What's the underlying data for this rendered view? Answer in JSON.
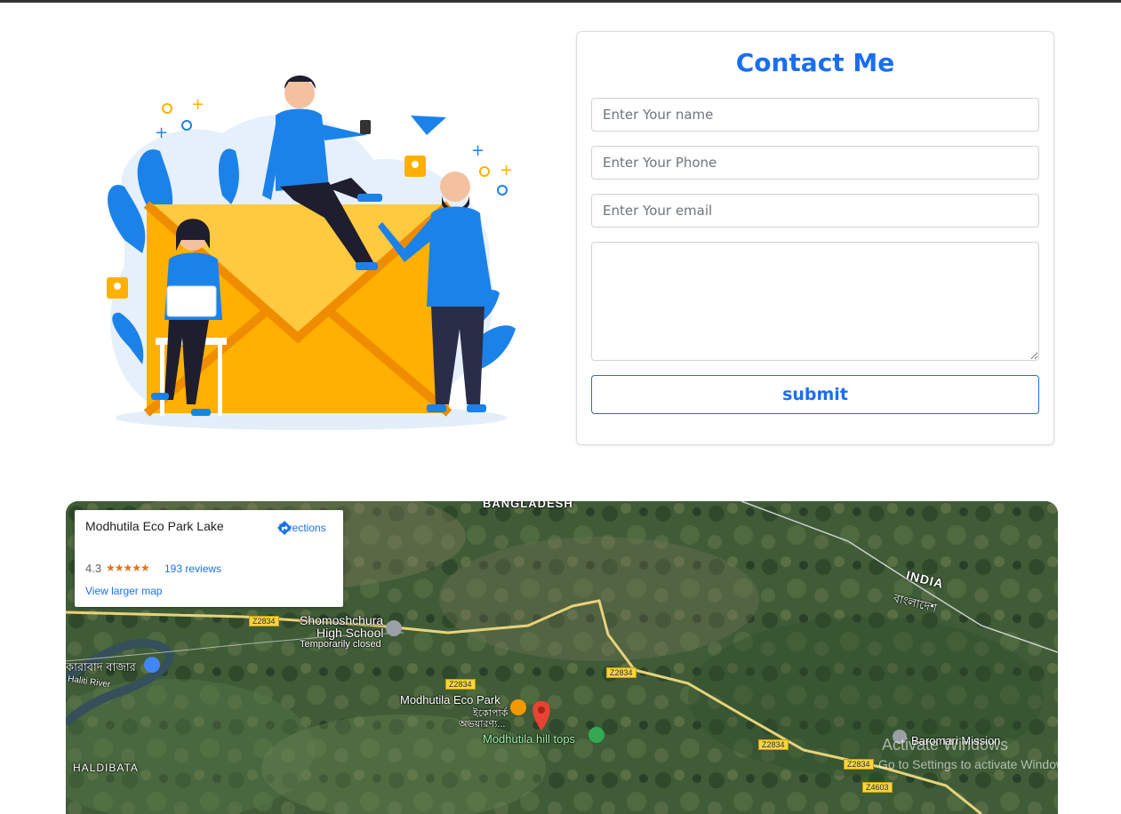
{
  "contact": {
    "title": "Contact Me",
    "name_placeholder": "Enter Your name",
    "phone_placeholder": "Enter Your Phone",
    "email_placeholder": "Enter Your email",
    "message_value": "",
    "submit_label": "submit"
  },
  "map": {
    "place_name": "Modhutila Eco Park Lake",
    "directions_label": "Directions",
    "rating": "4.3",
    "stars": "★★★★★",
    "reviews": "193 reviews",
    "larger_map": "View larger map",
    "labels": {
      "bangladesh": "BANGLADESH",
      "india": "INDIA",
      "india_bn": "বাংলাদেশ",
      "school_line1": "Shomoshchura",
      "school_line2": "High School",
      "school_status": "Temporarily closed",
      "bazar": "কারাবাদ বাজার",
      "river": "Haliti River",
      "eco_park": "Modhutila Eco Park",
      "eco_park_bn": "ইকোপার্ক",
      "eco_park_bn2": "অভয়ারণ্য...",
      "hill_tops": "Modhutila hill tops",
      "mission": "Baromari Mission",
      "haldibata": "HALDIBATA"
    },
    "roads": [
      "Z2834",
      "Z2834",
      "Z2834",
      "Z2834",
      "Z2834",
      "Z4603"
    ],
    "watermark_title": "Activate Windows",
    "watermark_sub": "Go to Settings to activate Windows."
  },
  "colors": {
    "accent": "#1a6ef0",
    "illustration_blue": "#1b82ea",
    "envelope": "#ffb000"
  }
}
